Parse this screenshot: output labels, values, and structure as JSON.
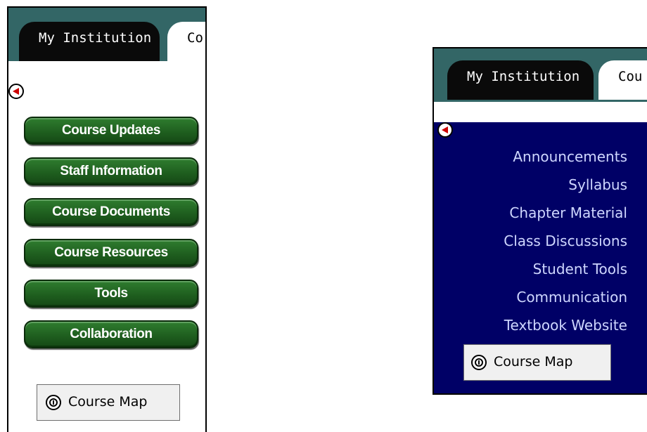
{
  "left_panel": {
    "tabs": [
      "My Institution",
      "Co"
    ],
    "buttons": [
      "Course Updates",
      "Staff Information",
      "Course Documents",
      "Course Resources",
      "Tools",
      "Collaboration"
    ],
    "course_map_label": "Course Map"
  },
  "right_panel": {
    "tabs": [
      "My Institution",
      "Cou"
    ],
    "links": [
      "Announcements",
      "Syllabus",
      "Chapter Material",
      "Class Discussions",
      "Student Tools",
      "Communication",
      "Textbook Website"
    ],
    "course_map_label": "Course Map"
  },
  "colors": {
    "tab_bar": "#336666",
    "menu_button_green": "#1f5f1f",
    "right_menu_bg": "#000066",
    "link_text": "#cfd7ff",
    "collapse_arrow": "#cc0000"
  },
  "icons": {
    "collapse": "collapse-left-arrow-icon",
    "course_map": "course-map-icon"
  }
}
